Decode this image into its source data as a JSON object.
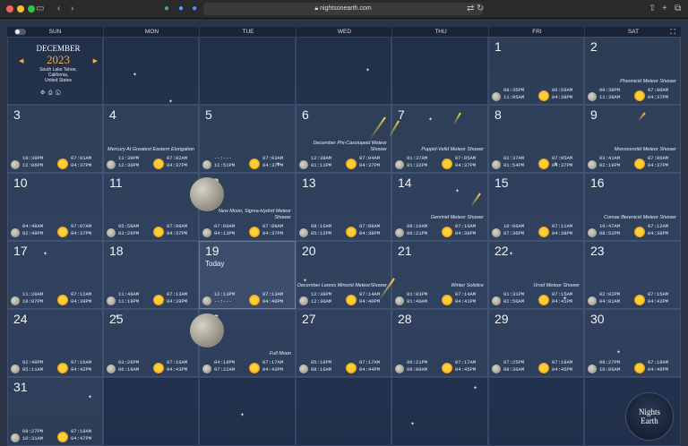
{
  "browser": {
    "url": "nightsonearth.com"
  },
  "header": {
    "days": [
      "SUN",
      "MON",
      "TUE",
      "WED",
      "THU",
      "FRI",
      "SAT"
    ]
  },
  "month_panel": {
    "month": "DECEMBER",
    "year": "2023",
    "location_line1": "South Lake Tahoe,",
    "location_line2": "California,",
    "location_line3": "United States"
  },
  "logo": {
    "line1": "Nights",
    "line2": "on",
    "line3": "Earth"
  },
  "days": [
    {
      "d": "1",
      "m1": "08:35PM",
      "m2": "11:05AM",
      "s1": "06:59AM",
      "s2": "04:38PM",
      "ev": ""
    },
    {
      "d": "2",
      "m1": "09:38PM",
      "m2": "11:38AM",
      "s1": "07:00AM",
      "s2": "04:37PM",
      "ev": "Pheonicid Meteor Shower"
    },
    {
      "d": "3",
      "m1": "10:39PM",
      "m2": "12:06PM",
      "s1": "07:01AM",
      "s2": "04:37PM",
      "ev": ""
    },
    {
      "d": "4",
      "m1": "11:39PM",
      "m2": "12:30PM",
      "s1": "07:02AM",
      "s2": "04:37PM",
      "ev": "Mercury At Greatest Eastern Elongation"
    },
    {
      "d": "5",
      "m1": "--:---",
      "m2": "12:51PM",
      "s1": "07:03AM",
      "s2": "04:37PM",
      "ev": ""
    },
    {
      "d": "6",
      "m1": "12:38AM",
      "m2": "01:11PM",
      "s1": "07:04AM",
      "s2": "04:37PM",
      "ev": "December Phi-Cassiopeid Meteor Shower"
    },
    {
      "d": "7",
      "m1": "01:37AM",
      "m2": "01:32PM",
      "s1": "07:05AM",
      "s2": "04:37PM",
      "ev": "Puppid-Velid Meteor Shower"
    },
    {
      "d": "8",
      "m1": "02:37AM",
      "m2": "01:54PM",
      "s1": "07:05AM",
      "s2": "04:37PM",
      "ev": ""
    },
    {
      "d": "9",
      "m1": "03:41AM",
      "m2": "02:19PM",
      "s1": "07:06AM",
      "s2": "04:37PM",
      "ev": "Monocerotid Meteor Shower"
    },
    {
      "d": "10",
      "m1": "04:48AM",
      "m2": "02:49PM",
      "s1": "07:07AM",
      "s2": "04:37PM",
      "ev": ""
    },
    {
      "d": "11",
      "m1": "05:58AM",
      "m2": "03:26PM",
      "s1": "07:08AM",
      "s2": "04:37PM",
      "ev": ""
    },
    {
      "d": "12",
      "m1": "07:09AM",
      "m2": "04:13PM",
      "s1": "07:09AM",
      "s2": "04:37PM",
      "ev": "New Moon, Sigma-Hydrid Meteor Shower"
    },
    {
      "d": "13",
      "m1": "08:16AM",
      "m2": "05:12PM",
      "s1": "07:09AM",
      "s2": "04:38PM",
      "ev": ""
    },
    {
      "d": "14",
      "m1": "09:16AM",
      "m2": "06:21PM",
      "s1": "07:10AM",
      "s2": "04:38PM",
      "ev": "Geminid Meteor Shower"
    },
    {
      "d": "15",
      "m1": "10:06AM",
      "m2": "07:36PM",
      "s1": "07:11AM",
      "s2": "04:38PM",
      "ev": ""
    },
    {
      "d": "16",
      "m1": "10:47AM",
      "m2": "08:52PM",
      "s1": "07:12AM",
      "s2": "04:38PM",
      "ev": "Comae Berenicid Meteor Shower"
    },
    {
      "d": "17",
      "m1": "11:20AM",
      "m2": "10:07PM",
      "s1": "07:12AM",
      "s2": "04:39PM",
      "ev": ""
    },
    {
      "d": "18",
      "m1": "11:48AM",
      "m2": "11:19PM",
      "s1": "07:13AM",
      "s2": "04:39PM",
      "ev": ""
    },
    {
      "d": "19",
      "m1": "12:13PM",
      "m2": "--:---",
      "s1": "07:13AM",
      "s2": "04:40PM",
      "ev": "",
      "today": "Today"
    },
    {
      "d": "20",
      "m1": "12:38PM",
      "m2": "12:30AM",
      "s1": "07:14AM",
      "s2": "04:40PM",
      "ev": "December Leonis Minorid MeteorShower"
    },
    {
      "d": "21",
      "m1": "01:03PM",
      "m2": "01:40AM",
      "s1": "07:14AM",
      "s2": "04:41PM",
      "ev": "Winter Solstice"
    },
    {
      "d": "22",
      "m1": "01:31PM",
      "m2": "02:50AM",
      "s1": "07:15AM",
      "s2": "04:41PM",
      "ev": "Ursid Meteor Shower"
    },
    {
      "d": "23",
      "m1": "02:02PM",
      "m2": "04:01AM",
      "s1": "07:15AM",
      "s2": "04:42PM",
      "ev": ""
    },
    {
      "d": "24",
      "m1": "02:40PM",
      "m2": "05:11AM",
      "s1": "07:16AM",
      "s2": "04:42PM",
      "ev": ""
    },
    {
      "d": "25",
      "m1": "03:26PM",
      "m2": "06:19AM",
      "s1": "07:16AM",
      "s2": "04:43PM",
      "ev": ""
    },
    {
      "d": "26",
      "m1": "04:19PM",
      "m2": "07:22AM",
      "s1": "07:17AM",
      "s2": "04:43PM",
      "ev": "Full Moon"
    },
    {
      "d": "27",
      "m1": "05:18PM",
      "m2": "08:16AM",
      "s1": "07:17AM",
      "s2": "04:44PM",
      "ev": ""
    },
    {
      "d": "28",
      "m1": "06:21PM",
      "m2": "09:00AM",
      "s1": "07:17AM",
      "s2": "04:45PM",
      "ev": ""
    },
    {
      "d": "29",
      "m1": "07:25PM",
      "m2": "09:36AM",
      "s1": "07:18AM",
      "s2": "04:45PM",
      "ev": ""
    },
    {
      "d": "30",
      "m1": "08:27PM",
      "m2": "10:06AM",
      "s1": "07:18AM",
      "s2": "04:46PM",
      "ev": ""
    },
    {
      "d": "31",
      "m1": "09:27PM",
      "m2": "10:31AM",
      "s1": "07:18AM",
      "s2": "04:47PM",
      "ev": ""
    }
  ]
}
